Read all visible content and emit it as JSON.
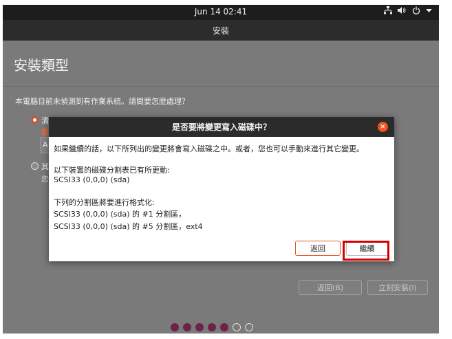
{
  "topbar": {
    "clock": "Jun 14  02:41",
    "icons": [
      "network-icon",
      "volume-icon",
      "power-icon",
      "dropdown-arrow-icon"
    ]
  },
  "window": {
    "title": "安裝",
    "heading": "安裝類型",
    "question": "本電腦目前未偵測到有作業系統。請問要怎麼處理？",
    "option1_visible": "清",
    "option1_warning_visible": "警",
    "option1_box_visible": "A",
    "option2_visible": "其",
    "option2_sub_visible": "您",
    "back_button": "返回(B)",
    "install_button": "立刻安裝(I)",
    "progress": {
      "total": 7,
      "completed": 5
    }
  },
  "dialog": {
    "title": "是否要將變更寫入磁碟中？",
    "close_glyph": "×",
    "intro": "如果繼續的話，以下所列出的變更將會寫入磁碟之中。或者，您也可以手動來進行其它變更。",
    "partition_table_heading": "以下裝置的磁碟分割表已有所更動:",
    "partition_table_device": "SCSI33 (0,0,0) (sda)",
    "format_heading": "下列的分割區將要進行格式化:",
    "format_items": [
      "SCSI33 (0,0,0) (sda) 的 #1 分割區，",
      "SCSI33 (0,0,0) (sda) 的 #5 分割區，ext4"
    ],
    "back_label": "返回",
    "continue_label": "繼續"
  },
  "colors": {
    "accent": "#e95420",
    "highlight": "#d40000",
    "progress_dot": "#6e2247"
  }
}
